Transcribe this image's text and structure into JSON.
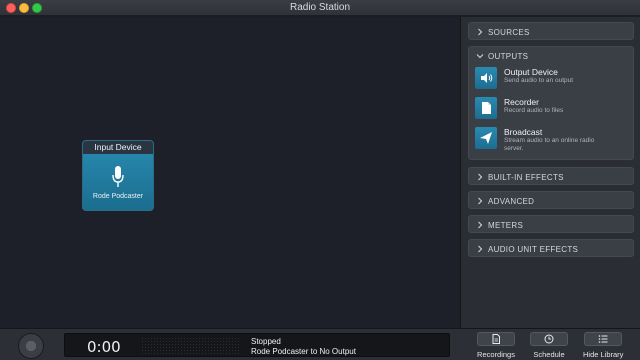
{
  "window": {
    "title": "Radio Station"
  },
  "node": {
    "header": "Input Device",
    "label": "Rode Podcaster",
    "icon": "microphone-icon"
  },
  "panel": {
    "sections": {
      "sources": "SOURCES",
      "outputs": "OUTPUTS",
      "builtin": "BUILT-IN EFFECTS",
      "advanced": "ADVANCED",
      "meters": "METERS",
      "au": "AUDIO UNIT EFFECTS"
    },
    "outputs": [
      {
        "name": "Output Device",
        "desc": "Send audio to an output",
        "icon": "speaker-icon"
      },
      {
        "name": "Recorder",
        "desc": "Record audio to files",
        "icon": "file-icon"
      },
      {
        "name": "Broadcast",
        "desc": "Stream audio to an online radio server.",
        "icon": "send-icon"
      }
    ]
  },
  "transport": {
    "time": "0:00",
    "status": "Stopped",
    "route": "Rode Podcaster to No Output"
  },
  "toolbar": {
    "recordings": "Recordings",
    "schedule": "Schedule",
    "hide_library": "Hide Library"
  },
  "colors": {
    "accent": "#2686ab",
    "background": "#1d2029"
  }
}
